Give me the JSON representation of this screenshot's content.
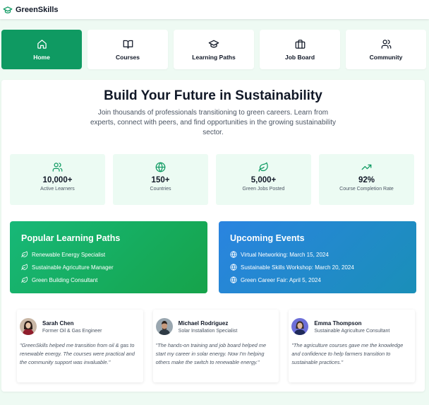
{
  "brand": {
    "name": "GreenSkills",
    "icon": "graduation-cap-icon",
    "color": "#0f9a62"
  },
  "nav": [
    {
      "label": "Home",
      "icon": "home-icon",
      "active": true
    },
    {
      "label": "Courses",
      "icon": "book-open-icon",
      "active": false
    },
    {
      "label": "Learning Paths",
      "icon": "graduation-cap-icon",
      "active": false
    },
    {
      "label": "Job Board",
      "icon": "briefcase-icon",
      "active": false
    },
    {
      "label": "Community",
      "icon": "users-icon",
      "active": false
    }
  ],
  "hero": {
    "title": "Build Your Future in Sustainability",
    "subtitle": "Join thousands of professionals transitioning to green careers. Learn from experts, connect with peers, and find opportunities in the growing sustainability sector."
  },
  "stats": [
    {
      "value": "10,000+",
      "label": "Active Learners",
      "icon": "users-icon"
    },
    {
      "value": "150+",
      "label": "Countries",
      "icon": "globe-icon"
    },
    {
      "value": "5,000+",
      "label": "Green Jobs Posted",
      "icon": "leaf-icon"
    },
    {
      "value": "92%",
      "label": "Course Completion Rate",
      "icon": "trending-up-icon"
    }
  ],
  "learning_paths": {
    "title": "Popular Learning Paths",
    "items": [
      "Renewable Energy Specialist",
      "Sustainable Agriculture Manager",
      "Green Building Consultant"
    ]
  },
  "events": {
    "title": "Upcoming Events",
    "items": [
      "Virtual Networking: March 15, 2024",
      "Sustainable Skills Workshop: March 20, 2024",
      "Green Career Fair: April 5, 2024"
    ]
  },
  "testimonials": [
    {
      "name": "Sarah Chen",
      "role": "Former Oil & Gas Engineer",
      "quote": "\"GreenSkills helped me transition from oil & gas to renewable energy. The courses were practical and the community support was invaluable.\""
    },
    {
      "name": "Michael Rodriguez",
      "role": "Solar Installation Specialist",
      "quote": "\"The hands-on training and job board helped me start my career in solar energy. Now I'm helping others make the switch to renewable energy.\""
    },
    {
      "name": "Emma Thompson",
      "role": "Sustainable Agriculture Consultant",
      "quote": "\"The agriculture courses gave me the knowledge and confidence to help farmers transition to sustainable practices.\""
    }
  ],
  "colors": {
    "accent": "#0f9a62",
    "green_panel": "#16a34a",
    "blue_panel": "#2a84e0",
    "page_bg": "#eefaf3",
    "stat_bg": "#ecfbf3"
  }
}
